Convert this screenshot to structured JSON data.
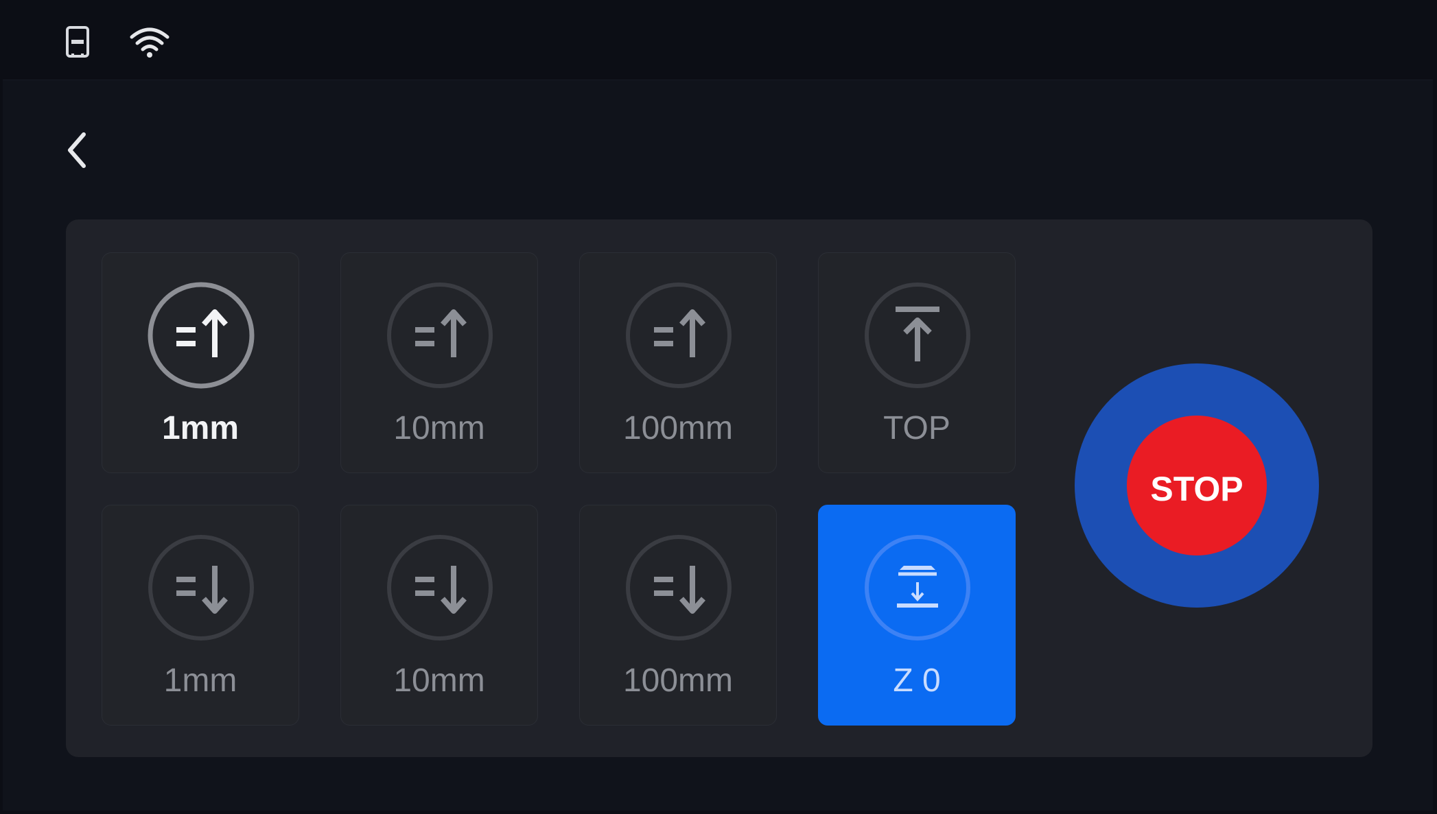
{
  "status_bar": {
    "icons": [
      "sd-card-icon",
      "wifi-icon"
    ]
  },
  "navigation": {
    "back_icon": "chevron-left-icon"
  },
  "move_up": [
    {
      "label": "1mm",
      "icon": "move-up-icon",
      "selected": true
    },
    {
      "label": "10mm",
      "icon": "move-up-icon",
      "selected": false
    },
    {
      "label": "100mm",
      "icon": "move-up-icon",
      "selected": false
    },
    {
      "label": "TOP",
      "icon": "move-to-top-icon",
      "selected": false
    }
  ],
  "move_down": [
    {
      "label": "1mm",
      "icon": "move-down-icon",
      "selected": false
    },
    {
      "label": "10mm",
      "icon": "move-down-icon",
      "selected": false
    },
    {
      "label": "100mm",
      "icon": "move-down-icon",
      "selected": false
    },
    {
      "label": "Z 0",
      "icon": "z-zero-icon",
      "selected": false,
      "active": true
    }
  ],
  "stop_button": {
    "label": "STOP"
  },
  "colors": {
    "background": "#10131b",
    "panel": "#202229",
    "tile": "#222429",
    "accent_blue": "#0b6bf2",
    "stop_outer": "#1c4fb4",
    "stop_red": "#ea1c24"
  }
}
